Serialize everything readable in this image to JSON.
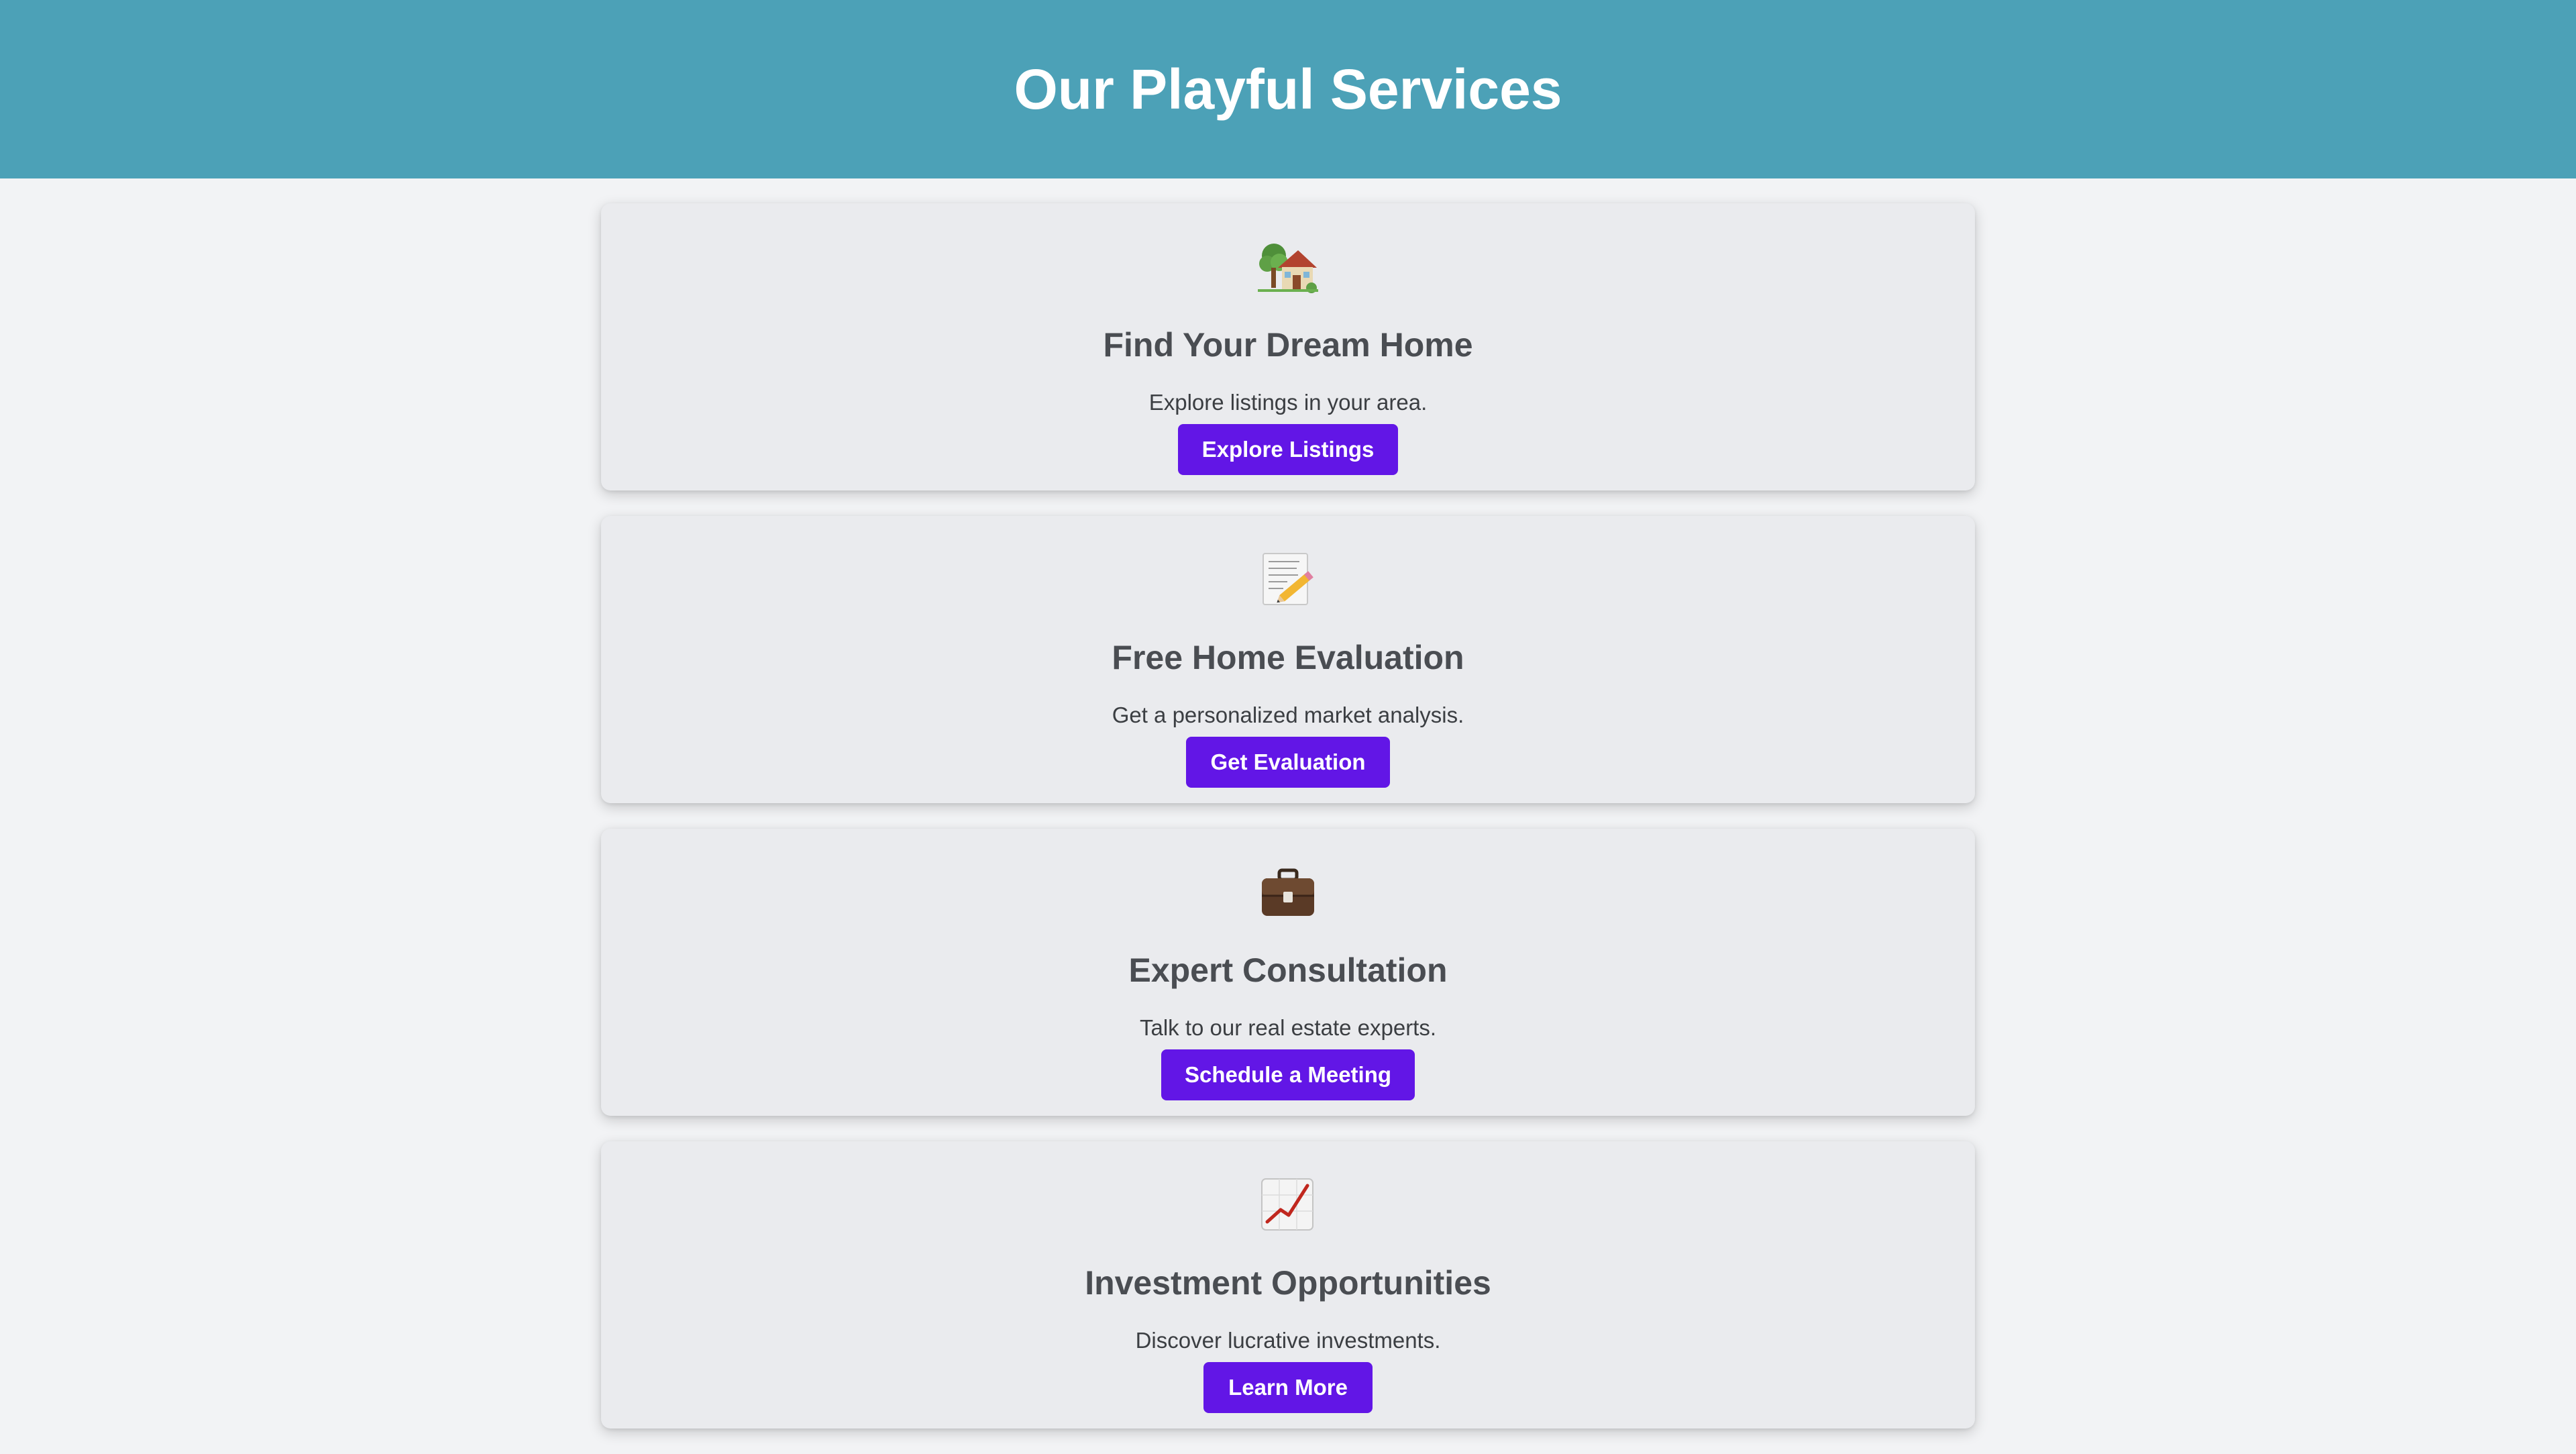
{
  "header": {
    "title": "Our Playful Services"
  },
  "colors": {
    "header_bg": "#4ca1b7",
    "page_bg": "#f2f3f5",
    "card_bg": "#eaebee",
    "button_bg": "#6216e6",
    "title_text": "#4a4d52"
  },
  "services": [
    {
      "icon": "house-with-tree-icon",
      "title": "Find Your Dream Home",
      "description": "Explore listings in your area.",
      "button": "Explore Listings"
    },
    {
      "icon": "memo-pencil-icon",
      "title": "Free Home Evaluation",
      "description": "Get a personalized market analysis.",
      "button": "Get Evaluation"
    },
    {
      "icon": "briefcase-icon",
      "title": "Expert Consultation",
      "description": "Talk to our real estate experts.",
      "button": "Schedule a Meeting"
    },
    {
      "icon": "chart-increasing-icon",
      "title": "Investment Opportunities",
      "description": "Discover lucrative investments.",
      "button": "Learn More"
    }
  ]
}
